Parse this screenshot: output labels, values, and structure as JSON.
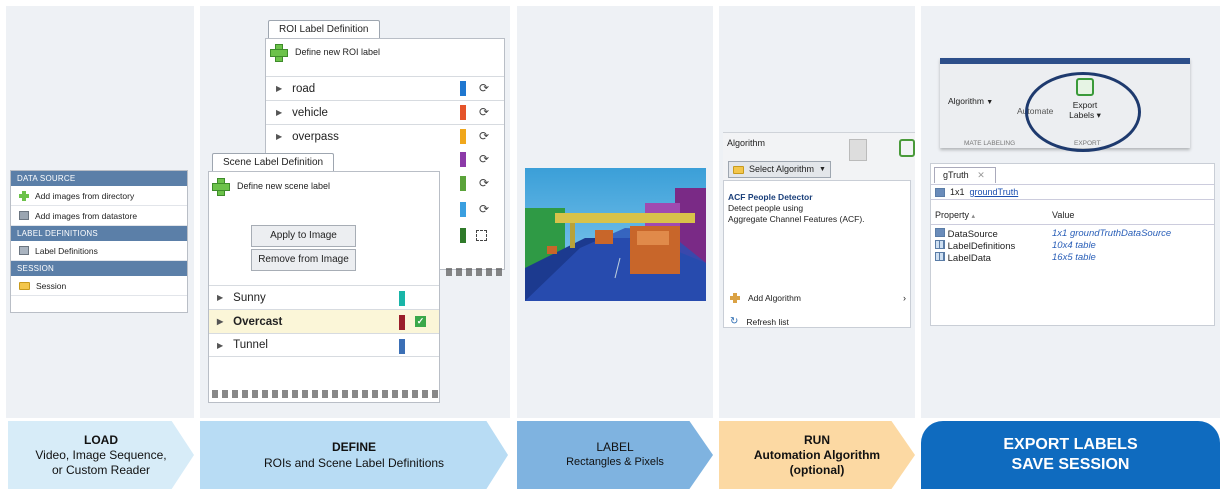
{
  "load_panel": {
    "sections": [
      {
        "header": "DATA SOURCE",
        "items": [
          "Add images from directory",
          "Add images from datastore"
        ]
      },
      {
        "header": "LABEL DEFINITIONS",
        "items": [
          "Label Definitions"
        ]
      },
      {
        "header": "SESSION",
        "items": [
          "Session"
        ]
      }
    ]
  },
  "define_panel": {
    "roi_tab": "ROI Label Definition",
    "roi_new_label": "Define new ROI label",
    "roi_labels": [
      {
        "name": "road",
        "color": "#1f77d0"
      },
      {
        "name": "vehicle",
        "color": "#e5542a"
      },
      {
        "name": "overpass",
        "color": "#f0a71c"
      },
      {
        "name": "",
        "color": "#8c3aa8"
      },
      {
        "name": "",
        "color": "#5aa33a"
      },
      {
        "name": "",
        "color": "#3a9fe0"
      },
      {
        "name": "",
        "color": "#2f7a2a"
      }
    ],
    "scene_tab": "Scene Label Definition",
    "scene_new_label": "Define new scene label",
    "apply_button": "Apply to Image",
    "remove_button": "Remove from Image",
    "scene_labels": [
      {
        "name": "Sunny",
        "color": "#19b5a8"
      },
      {
        "name": "Overcast",
        "color": "#9a1e2a"
      },
      {
        "name": "Tunnel",
        "color": "#3b6fb5"
      }
    ]
  },
  "run_panel": {
    "algorithm_label": "Algorithm",
    "select_button": "Select Algorithm",
    "detector_title": "ACF People Detector",
    "detector_desc_1": "Detect people using",
    "detector_desc_2": "Aggregate Channel Features (ACF).",
    "add_algorithm": "Add Algorithm",
    "refresh_list": "Refresh list"
  },
  "export_panel": {
    "algorithm_label": "Algorithm",
    "automate_label": "Automate",
    "export_label_1": "Export",
    "export_label_2": "Labels",
    "section_left": "MATE LABELING",
    "section_right": "EXPORT",
    "gtruth_tab": "gTruth",
    "object_prefix": "1x1",
    "object_link": "groundTruth",
    "col_property": "Property",
    "col_value": "Value",
    "properties": [
      {
        "name": "DataSource",
        "value": "1x1 groundTruthDataSource"
      },
      {
        "name": "LabelDefinitions",
        "value": "10x4 table"
      },
      {
        "name": "LabelData",
        "value": "16x5 table"
      }
    ]
  },
  "steps": [
    {
      "title": "LOAD",
      "line1": "Video, Image Sequence,",
      "line2": "or Custom Reader",
      "color": "#d7ecf8"
    },
    {
      "title": "DEFINE",
      "line1": "ROIs and Scene Label Definitions",
      "line2": "",
      "color": "#b8dcf4"
    },
    {
      "title": "LABEL",
      "line1": "Rectangles & Pixels",
      "line2": "",
      "color": "#7fb3e0"
    },
    {
      "title": "RUN",
      "line1": "Automation Algorithm",
      "line2": "(optional)",
      "color": "#fcd9a3"
    },
    {
      "title": "EXPORT LABELS",
      "line1": "SAVE SESSION",
      "line2": "",
      "color": "#0f6bbf"
    }
  ]
}
